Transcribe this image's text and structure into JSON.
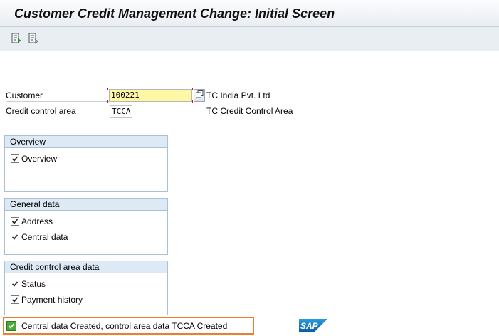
{
  "window": {
    "title": "Customer Credit Management Change: Initial Screen"
  },
  "toolbar": {
    "buttons": [
      {
        "icon": "document-arrow-icon"
      },
      {
        "icon": "document-list-icon"
      }
    ]
  },
  "form": {
    "customer_label": "Customer",
    "customer_value": "100221",
    "customer_desc": "TC India Pvt. Ltd",
    "cca_label": "Credit control area",
    "cca_value": "TCCA",
    "cca_desc": "TC Credit Control Area"
  },
  "groups": {
    "overview": {
      "title": "Overview",
      "items": [
        {
          "label": "Overview",
          "checked": true
        }
      ]
    },
    "general": {
      "title": "General data",
      "items": [
        {
          "label": "Address",
          "checked": true
        },
        {
          "label": "Central data",
          "checked": true
        }
      ]
    },
    "credit": {
      "title": "Credit control area data",
      "items": [
        {
          "label": "Status",
          "checked": true
        },
        {
          "label": "Payment history",
          "checked": true
        }
      ]
    }
  },
  "status": {
    "type": "success",
    "message": "Central data Created, control area data TCCA Created",
    "logo": "SAP"
  },
  "colors": {
    "status_highlight": "#ee7d31",
    "required_field": "#fff6a6",
    "group_header": "#dde9f5",
    "success": "#4aa83a"
  }
}
